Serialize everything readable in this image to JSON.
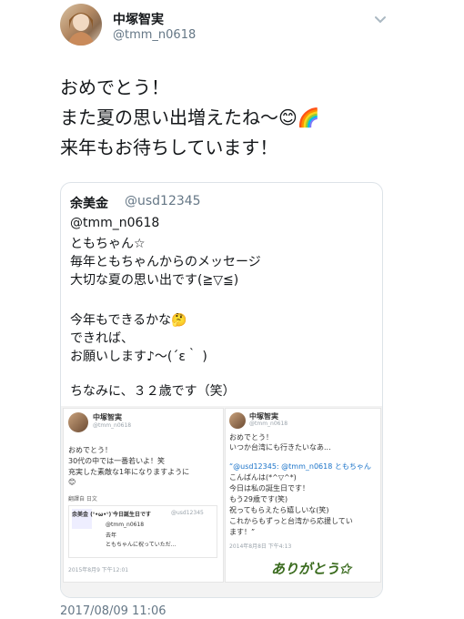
{
  "tweet": {
    "author_name": "中塚智実",
    "author_handle": "@tmm_n0618",
    "lines": [
      "おめでとう！",
      "また夏の思い出増えたね〜😊🌈",
      "来年もお待ちしています！"
    ],
    "timestamp": "2017/08/09 11:06"
  },
  "quote": {
    "author_name": "余美金",
    "author_handle": "@usd12345",
    "lines": [
      "@tmm_n0618",
      "ともちゃん☆",
      "毎年ともちゃんからのメッセージ",
      "大切な夏の思い出です(≧▽≦)",
      "",
      "今年もできるかな🤔",
      "できれば、",
      "お願いします♪〜(´ε｀ )",
      "",
      "ちなみに、３２歳です（笑）"
    ]
  },
  "screenshot_left": {
    "name": "中塚智実",
    "handle": "@tmm_n0618",
    "lines": [
      "おめでとう！",
      "30代の中では一番若いよ！笑",
      "充実した素敵な1年になりますように",
      "😊"
    ],
    "translate": "翻譯自 日文",
    "inner_name": "余美金 (ᐡ•ω•ᐡ)ᐝ今日誕生日です",
    "inner_handle": "@usd12345",
    "inner_lines": [
      "@tmm_n0618",
      "去年",
      "ともちゃんに祝っていただ..."
    ],
    "date": "2015年8月9 下午12:01"
  },
  "screenshot_right": {
    "name": "中塚智実",
    "handle": "@tmm_n0618",
    "lines": [
      "おめでとう！",
      "いつか台湾にも行きたいなあ..."
    ],
    "quote_lines": [
      "“@usd12345: @tmm_n0618 ともちゃん",
      "こんばんは(*^▽^*)",
      "今日は私の誕生日です！",
      "もう29歳です(笑)",
      "祝ってもらえたら嬉しいな(笑)",
      "これからもずっと台湾から応援してい",
      "ます！”"
    ],
    "date": "2014年8月8日 下午4:13",
    "thanks": "ありがとう✩"
  }
}
